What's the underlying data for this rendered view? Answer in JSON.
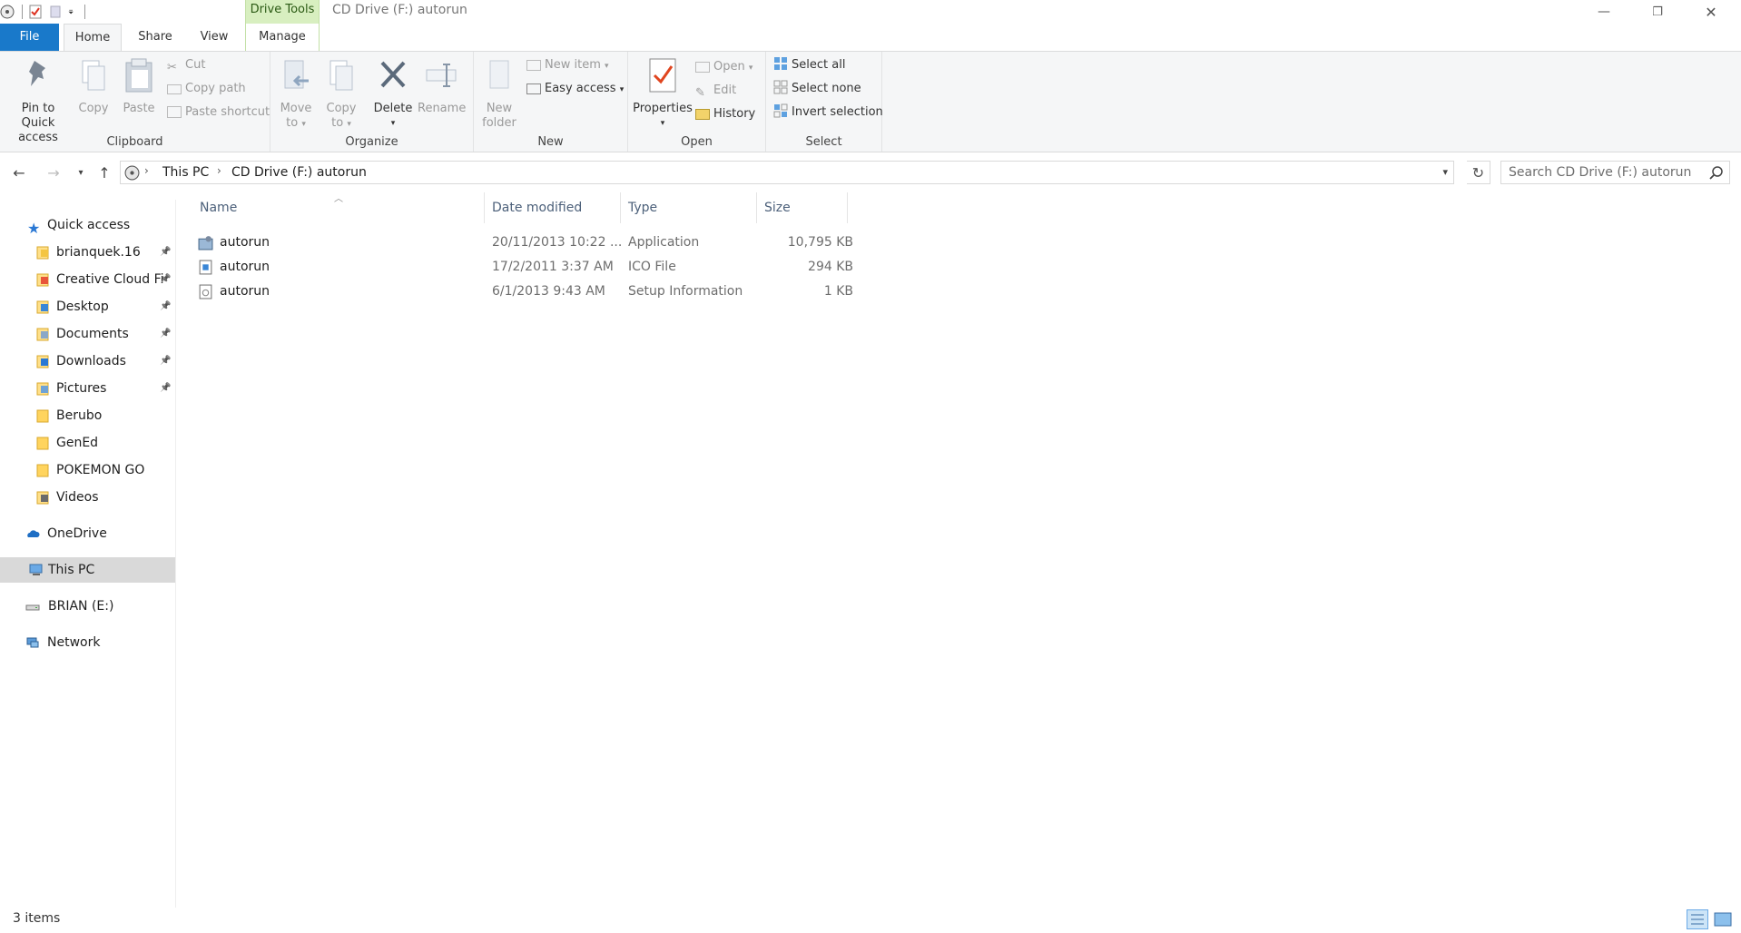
{
  "window": {
    "title": "CD Drive (F:) autorun",
    "context_tab": "Drive Tools",
    "minimize_glyph": "—",
    "restore_glyph": "❐",
    "close_glyph": "✕"
  },
  "tabs": {
    "file": "File",
    "home": "Home",
    "share": "Share",
    "view": "View",
    "manage": "Manage"
  },
  "ribbon": {
    "clipboard": {
      "label": "Clipboard",
      "pin_line1": "Pin to Quick",
      "pin_line2": "access",
      "copy": "Copy",
      "paste": "Paste",
      "cut": "Cut",
      "copy_path": "Copy path",
      "paste_shortcut": "Paste shortcut"
    },
    "organize": {
      "label": "Organize",
      "move_line1": "Move",
      "move_line2": "to",
      "copy_line1": "Copy",
      "copy_line2": "to",
      "delete": "Delete",
      "rename": "Rename"
    },
    "new": {
      "label": "New",
      "new_folder_line1": "New",
      "new_folder_line2": "folder",
      "new_item": "New item",
      "easy_access": "Easy access"
    },
    "open": {
      "label": "Open",
      "properties": "Properties",
      "open": "Open",
      "edit": "Edit",
      "history": "History"
    },
    "select": {
      "label": "Select",
      "select_all": "Select all",
      "select_none": "Select none",
      "invert_selection": "Invert selection"
    }
  },
  "address": {
    "crumbs": [
      "This PC",
      "CD Drive (F:) autorun"
    ],
    "search_placeholder": "Search CD Drive (F:) autorun"
  },
  "navpane": {
    "quick_access": "Quick access",
    "items": [
      {
        "label": "brianquek.16",
        "pinned": true
      },
      {
        "label": "Creative Cloud Fi",
        "pinned": true
      },
      {
        "label": "Desktop",
        "pinned": true
      },
      {
        "label": "Documents",
        "pinned": true
      },
      {
        "label": "Downloads",
        "pinned": true
      },
      {
        "label": "Pictures",
        "pinned": true
      },
      {
        "label": "Berubo",
        "pinned": false
      },
      {
        "label": "GenEd",
        "pinned": false
      },
      {
        "label": "POKEMON GO",
        "pinned": false
      },
      {
        "label": "Videos",
        "pinned": false
      }
    ],
    "onedrive": "OneDrive",
    "this_pc": "This PC",
    "brian": "BRIAN (E:)",
    "network": "Network"
  },
  "filelist": {
    "columns": [
      "Name",
      "Date modified",
      "Type",
      "Size"
    ],
    "rows": [
      {
        "name": "autorun",
        "date": "20/11/2013 10:22 ...",
        "type": "Application",
        "size": "10,795 KB"
      },
      {
        "name": "autorun",
        "date": "17/2/2011 3:37 AM",
        "type": "ICO File",
        "size": "294 KB"
      },
      {
        "name": "autorun",
        "date": "6/1/2013 9:43 AM",
        "type": "Setup Information",
        "size": "1 KB"
      }
    ]
  },
  "status": {
    "item_count": "3 items"
  },
  "colors": {
    "accent": "#1979ca",
    "context_green": "#d8efc0",
    "selected_bg": "#d9d9d9"
  }
}
